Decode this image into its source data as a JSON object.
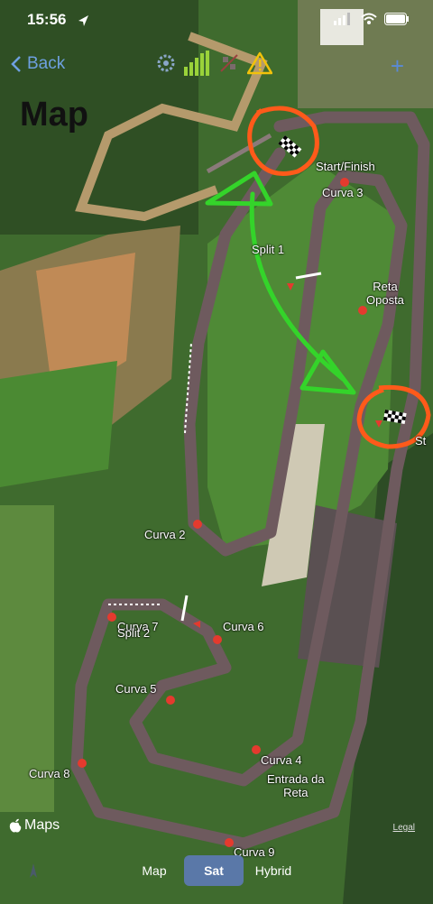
{
  "status_bar": {
    "time": "15:56"
  },
  "nav": {
    "back_label": "Back",
    "title": "Map",
    "add_symbol": "+"
  },
  "toolbar_icons": [
    "gear-icon",
    "signal-bars-icon",
    "satellite-off-icon",
    "warning-icon"
  ],
  "map": {
    "labels": {
      "start_finish": "Start/Finish",
      "curva3": "Curva 3",
      "split1": "Split 1",
      "reta_oposta": "Reta\nOposta",
      "curva2": "Curva 2",
      "curva7": "Curva 7",
      "split2": "Split 2",
      "curva6": "Curva 6",
      "curva5": "Curva 5",
      "curva4": "Curva 4",
      "entrada": "Entrada da\nReta",
      "curva8": "Curva 8",
      "curva9": "Curva 9",
      "st": "St"
    },
    "attribution": "Maps",
    "legal": "Legal",
    "map_types": [
      "Map",
      "Sat",
      "Hybrid"
    ],
    "selected_type": "Sat"
  },
  "colors": {
    "track": "#6e5a5e",
    "annotation_green": "#34d42a",
    "annotation_orange": "#ff5a1a",
    "marker_red": "#e43a2e"
  }
}
